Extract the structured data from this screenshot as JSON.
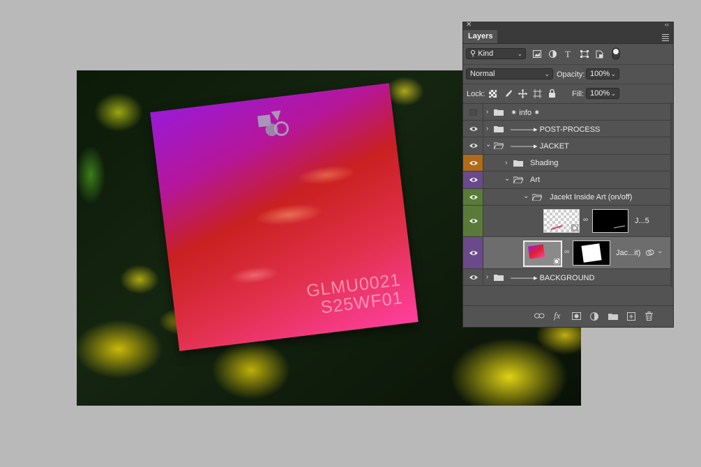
{
  "canvas": {
    "jacket_text_line1": "GLMU0021",
    "jacket_text_line2": "S25WF01"
  },
  "panel": {
    "tab_label": "Layers",
    "filter_label": "Kind",
    "blend_mode": "Normal",
    "opacity_label": "Opacity:",
    "opacity_value": "100%",
    "lock_label": "Lock:",
    "fill_label": "Fill:",
    "fill_value": "100%"
  },
  "layers": [
    {
      "name": "⁕ info ⁕",
      "visible": false
    },
    {
      "name": "———▸ POST-PROCESS",
      "visible": true
    },
    {
      "name": "———▸ JACKET",
      "visible": true,
      "expanded": true
    },
    {
      "name": "Shading",
      "visible": true,
      "color": "#b16a1a"
    },
    {
      "name": "Art",
      "visible": true,
      "color": "#6a4a8a",
      "expanded": true
    },
    {
      "name": "Jacekt Inside Art (on/off)",
      "visible": true,
      "color": "#5a7a3a",
      "expanded": true
    },
    {
      "name": "J...5",
      "visible": true,
      "color": "#5a7a3a"
    },
    {
      "name": "Jac...it)",
      "visible": true,
      "color": "#6a4a8a",
      "selected": true
    },
    {
      "name": "———▸ BACKGROUND",
      "visible": true
    }
  ],
  "colors": {
    "panel_bg": "#535353",
    "tab_bar": "#3a3a3a",
    "canvas_bg": "#b9b9b9"
  }
}
